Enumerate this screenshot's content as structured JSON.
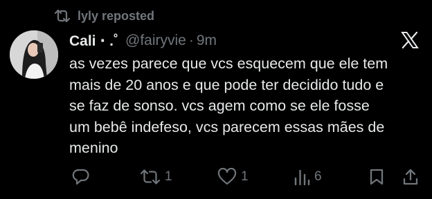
{
  "repost": {
    "text": "lyly reposted",
    "icon": "repost-icon"
  },
  "author": {
    "display_name": "Cali ⋅ .˚",
    "handle": "@fairyvie",
    "separator": "·",
    "time": "9m"
  },
  "brand": {
    "icon": "x-logo-icon"
  },
  "tweet": {
    "lines": [
      "as vezes parece que vcs esquecem que ele tem",
      "mais de 20 anos e que pode ter decidido tudo e",
      "se faz de sonso. vcs agem como se ele fosse",
      "um bebê indefeso, vcs parecem essas mães de",
      "menino"
    ]
  },
  "actions": {
    "reply": {
      "icon": "reply-icon",
      "count": ""
    },
    "retweet": {
      "icon": "retweet-icon",
      "count": "1"
    },
    "like": {
      "icon": "like-icon",
      "count": "1"
    },
    "views": {
      "icon": "views-icon",
      "count": "6"
    },
    "bookmark": {
      "icon": "bookmark-icon"
    },
    "share": {
      "icon": "share-icon"
    }
  },
  "colors": {
    "background": "#000000",
    "text": "#e7e9ea",
    "muted": "#71767b"
  }
}
